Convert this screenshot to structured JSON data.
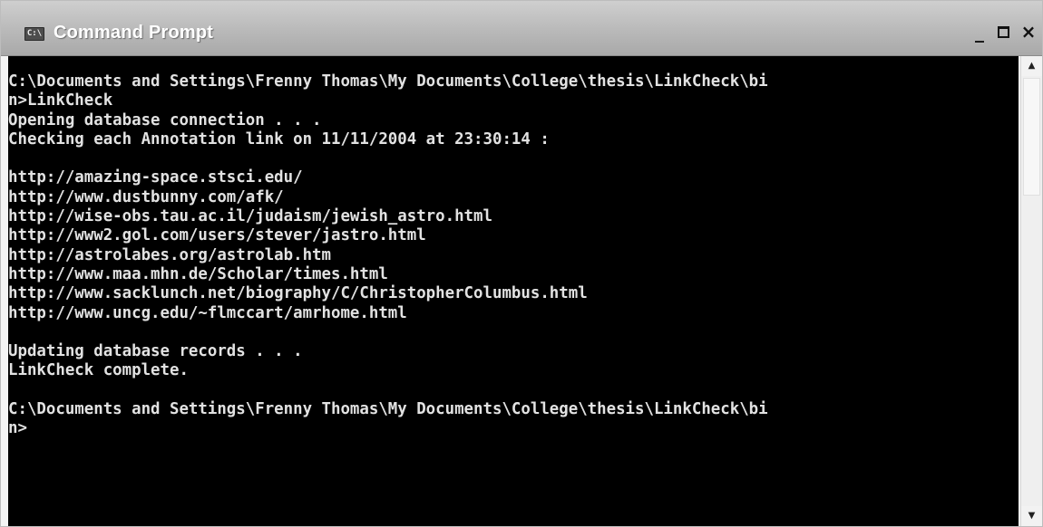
{
  "window": {
    "title": "Command Prompt",
    "icon": "console-app-icon",
    "icon_glyph": "C:\\",
    "controls": {
      "minimize": "_",
      "close": "×"
    }
  },
  "console": {
    "lines": [
      "C:\\Documents and Settings\\Frenny Thomas\\My Documents\\College\\thesis\\LinkCheck\\bi",
      "n>LinkCheck",
      "Opening database connection . . .",
      "Checking each Annotation link on 11/11/2004 at 23:30:14 :",
      "",
      "http://amazing-space.stsci.edu/",
      "http://www.dustbunny.com/afk/",
      "http://wise-obs.tau.ac.il/judaism/jewish_astro.html",
      "http://www2.gol.com/users/stever/jastro.html",
      "http://astrolabes.org/astrolab.htm",
      "http://www.maa.mhn.de/Scholar/times.html",
      "http://www.sacklunch.net/biography/C/ChristopherColumbus.html",
      "http://www.uncg.edu/~flmccart/amrhome.html",
      "",
      "Updating database records . . .",
      "LinkCheck complete.",
      "",
      "C:\\Documents and Settings\\Frenny Thomas\\My Documents\\College\\thesis\\LinkCheck\\bi",
      "n>"
    ]
  },
  "scrollbar": {
    "up_glyph": "▲",
    "down_glyph": "▼"
  }
}
